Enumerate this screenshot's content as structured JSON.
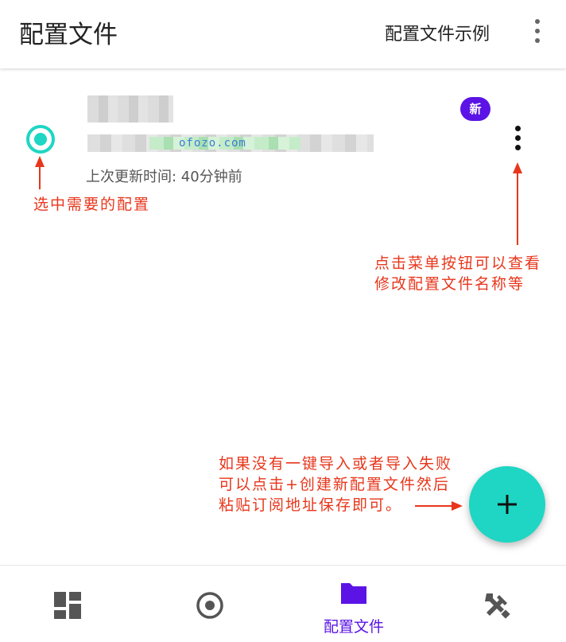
{
  "appbar": {
    "title": "配置文件",
    "example_label": "配置文件示例",
    "overflow_icon": "more-vert-icon"
  },
  "profile": {
    "watermark": "ofozo.com",
    "updated": "上次更新时间: 40分钟前",
    "badge": "新",
    "selected": true
  },
  "annotations": {
    "select": "选中需要的配置",
    "menu_line1": "点击菜单按钮可以查看",
    "menu_line2": "修改配置文件名称等",
    "fab_line1": "如果没有一键导入或者导入失败",
    "fab_line2": "可以点击+创建新配置文件然后",
    "fab_line3": "粘贴订阅地址保存即可。"
  },
  "fab": {
    "icon": "plus-icon"
  },
  "bottom_nav": {
    "active_label": "配置文件",
    "items": [
      {
        "icon": "dashboard-icon"
      },
      {
        "icon": "radio-target-icon"
      },
      {
        "icon": "folder-icon",
        "label": "配置文件",
        "active": true
      },
      {
        "icon": "tools-icon"
      }
    ]
  },
  "colors": {
    "accent": "#1ed6c3",
    "primary": "#5b14e5",
    "annotation": "#e8361b"
  }
}
